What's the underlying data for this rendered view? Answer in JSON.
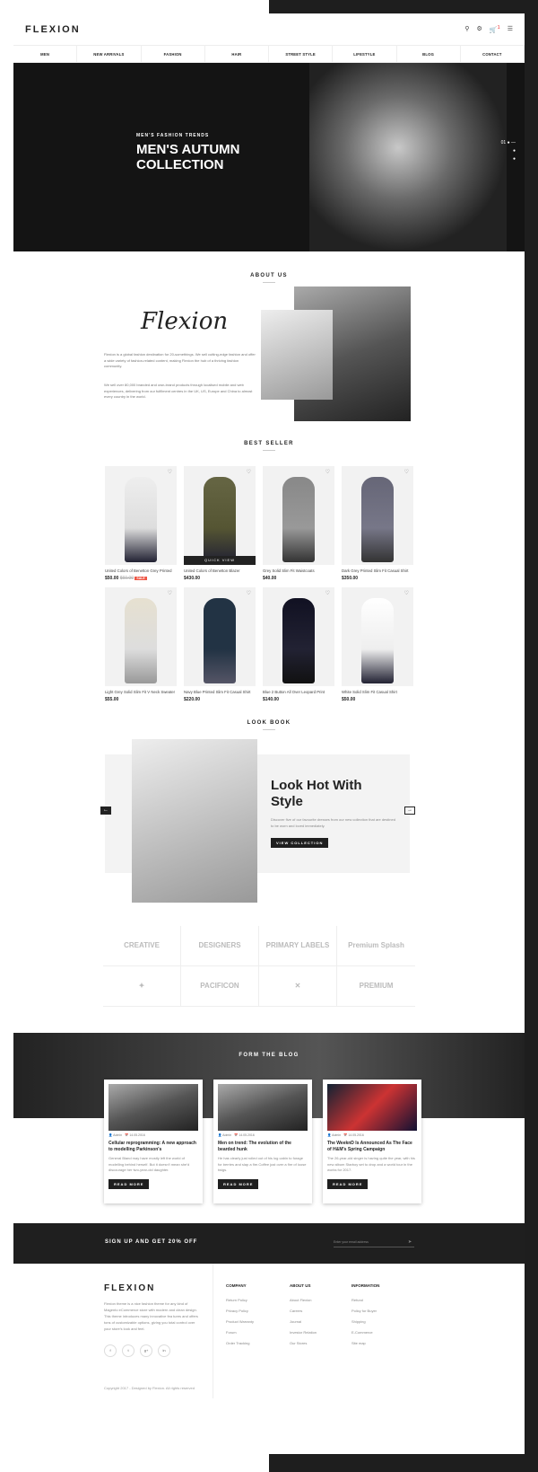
{
  "header": {
    "logo": "FLEXION",
    "cart_count": "1"
  },
  "nav": [
    "Men",
    "New Arrivals",
    "Fashion",
    "Hair",
    "Street Style",
    "Lifestyle",
    "Blog",
    "Contact"
  ],
  "hero": {
    "kicker": "MEN'S FASHION TRENDS",
    "title": "MEN'S AUTUMN COLLECTION",
    "slide": "01"
  },
  "about": {
    "title": "ABOUT US",
    "brand": "Flexion",
    "p1": "Flexion is a global fashion destination for 20-somethings. We sell cutting-edge fashion and offer a wide variety of fashion-related content, making Flexion the hub of a thriving fashion community.",
    "p2": "We sell over 80,000 branded and own-brand products through localised mobile and web experiences, delivering from our fulfilment centres in the UK, US, Europe and China to almost every country in the world."
  },
  "best": {
    "title": "BEST SELLER",
    "quick_view": "QUICK VIEW",
    "sale": "SALE",
    "products": [
      {
        "name": "United Colors of Benetton Grey Printed",
        "price": "$50.00",
        "old": "$60.00"
      },
      {
        "name": "United Colors of Benetton Blazer",
        "price": "$430.00"
      },
      {
        "name": "Grey Solid Slim Fit Waistcoats",
        "price": "$40.00"
      },
      {
        "name": "Dark Grey Printed Slim Fit Casual Shirt",
        "price": "$350.00"
      },
      {
        "name": "Light Grey Solid Slim Fit V Neck Sweater",
        "price": "$55.00"
      },
      {
        "name": "Navy Blue Printed Slim Fit Casual Shirt",
        "price": "$220.00"
      },
      {
        "name": "Blue 2 Button All Over Leopard Print",
        "price": "$140.00"
      },
      {
        "name": "White Solid Slim Fit Casual Shirt",
        "price": "$50.00"
      }
    ]
  },
  "lookbook": {
    "title": "LOOK BOOK",
    "heading": "Look Hot With Style",
    "text": "Discover five of our favourite dresses from our new collection that are destined to be worn and loved immediately.",
    "button": "VIEW COLLECTION"
  },
  "brands": [
    "CREATIVE",
    "DESIGNERS",
    "PRIMARY LABELS",
    "Premium Splash",
    "",
    "PACIFICON",
    "",
    "PREMIUM"
  ],
  "blog": {
    "title": "FORM THE BLOG",
    "button": "READ MORE",
    "posts": [
      {
        "author": "Admin",
        "date": "14.05.2016",
        "title": "Cellular reprogramming: A new approach to modelling Parkinson's",
        "text": "General Bland may have mostly left the world of modelling behind herself. But it doesn't mean she'd discourage her two-year-old daughter."
      },
      {
        "author": "Admin",
        "date": "14.05.2016",
        "title": "Men on trend: The evolution of the bearded hunk",
        "text": "He has clearly just rolled out of his log cabin to forage for berries and slap a fire.Coffee just over a fire of loose twigs."
      },
      {
        "author": "Admin",
        "date": "14.05.2016",
        "title": "The WeeknD Is Announced As The Face of H&M's Spring Campaign",
        "text": "The 26-year-old singer is having quite the year, with his new album Starboy set to drop and a world tour in the works for 2017."
      }
    ]
  },
  "signup": {
    "text": "SIGN UP AND GET 20% OFF",
    "placeholder": "Enter your email address"
  },
  "footer": {
    "logo": "FLEXION",
    "desc": "Flexion theme is a nice fashion theme for any kind of Magento eCommerce store with modern and clean design. This theme introduces many innovative fea tures and offers tons of customizable options, giving you total control over your store's look and feel.",
    "social": [
      "f",
      "t",
      "g+",
      "in"
    ],
    "cols": [
      {
        "title": "COMPANY",
        "items": [
          "Return Policy",
          "Privacy Policy",
          "Product Warranty",
          "Forum",
          "Order Tracking"
        ]
      },
      {
        "title": "ABOUT US",
        "items": [
          "About Flexion",
          "Careers",
          "Journal",
          "Investor Relation",
          "Our Stores"
        ]
      },
      {
        "title": "INFORMATION",
        "items": [
          "Refund",
          "Policy for Buyer",
          "Shipping",
          "E-Commerce",
          "Site map"
        ]
      }
    ],
    "copyright": "Copyright 2017 - Designed by Flexion. All rights reserved"
  }
}
